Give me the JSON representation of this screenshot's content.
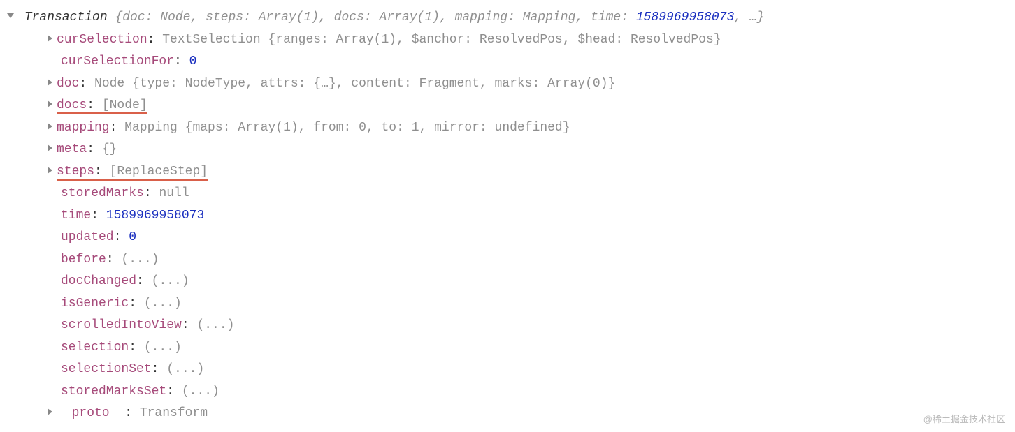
{
  "header": {
    "className": "Transaction",
    "preview": {
      "p1": "{doc: ",
      "p2": "Node",
      "p3": ", steps: ",
      "p4": "Array(1)",
      "p5": ", docs: ",
      "p6": "Array(1)",
      "p7": ", mapping: ",
      "p8": "Mapping",
      "p9": ", time: ",
      "p10": "1589969958073",
      "p11": ", …}"
    }
  },
  "props": {
    "curSelection": {
      "key": "curSelection",
      "val": "TextSelection {ranges: Array(1), $anchor: ResolvedPos, $head: ResolvedPos}"
    },
    "curSelectionFor": {
      "key": "curSelectionFor",
      "val": "0"
    },
    "doc": {
      "key": "doc",
      "val": "Node {type: NodeType, attrs: {…}, content: Fragment, marks: Array(0)}"
    },
    "docs": {
      "key": "docs",
      "val": "[Node]"
    },
    "mapping": {
      "key": "mapping",
      "val": "Mapping {maps: Array(1), from: 0, to: 1, mirror: undefined}"
    },
    "meta": {
      "key": "meta",
      "val": "{}"
    },
    "steps": {
      "key": "steps",
      "val": "[ReplaceStep]"
    },
    "storedMarks": {
      "key": "storedMarks",
      "val": "null"
    },
    "time": {
      "key": "time",
      "val": "1589969958073"
    },
    "updated": {
      "key": "updated",
      "val": "0"
    },
    "before": {
      "key": "before",
      "val": "(...)"
    },
    "docChanged": {
      "key": "docChanged",
      "val": "(...)"
    },
    "isGeneric": {
      "key": "isGeneric",
      "val": "(...)"
    },
    "scrolledIntoView": {
      "key": "scrolledIntoView",
      "val": "(...)"
    },
    "selection": {
      "key": "selection",
      "val": "(...)"
    },
    "selectionSet": {
      "key": "selectionSet",
      "val": "(...)"
    },
    "storedMarksSet": {
      "key": "storedMarksSet",
      "val": "(...)"
    },
    "proto": {
      "key": "__proto__",
      "val": "Transform"
    }
  },
  "watermark": "@稀土掘金技术社区"
}
